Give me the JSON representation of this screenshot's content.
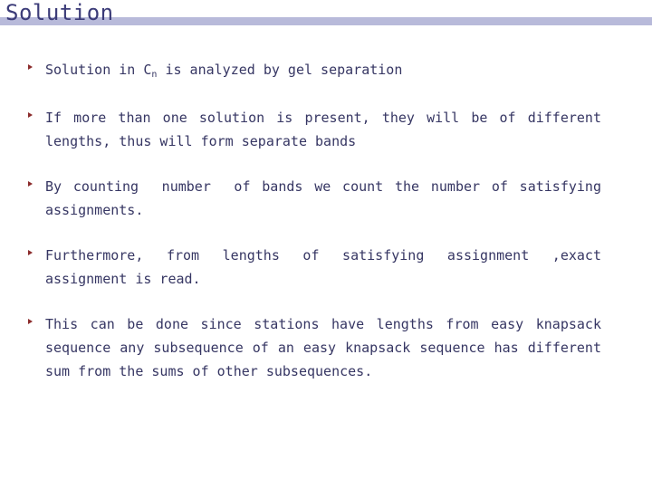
{
  "slide": {
    "title": "Solution",
    "accent_rule_color": "#b8bada",
    "title_color": "#3b3b78",
    "body_text_color": "#363663",
    "bullet_marker_color": "#8b2b2b",
    "background_color": "#ffffff",
    "bullets": [
      {
        "id": "bullet-1",
        "text_before_sub": "Solution in C",
        "subscript": "n",
        "text_after_sub": " is analyzed by gel separation",
        "full_text": "Solution in Cn is analyzed by gel separation"
      },
      {
        "id": "bullet-2",
        "full_text": "If more than one solution is present, they will be of different lengths, thus will form separate bands"
      },
      {
        "id": "bullet-3",
        "full_text": "By counting  number  of bands we count the number of satisfying assignments."
      },
      {
        "id": "bullet-4",
        "full_text": "Furthermore, from lengths of satisfying assignment ,exact assignment is read."
      },
      {
        "id": "bullet-5",
        "full_text": "This can be done since stations have lengths from easy knapsack sequence any subsequence of an easy knapsack sequence has different sum from the sums of other subsequences."
      }
    ]
  }
}
